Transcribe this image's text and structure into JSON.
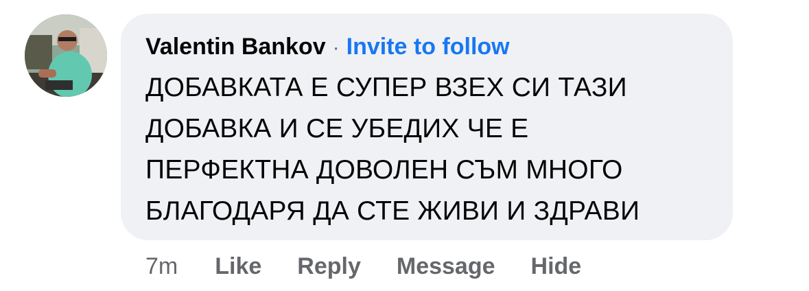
{
  "comment": {
    "author": "Valentin Bankov",
    "separator": "·",
    "invite_label": "Invite to follow",
    "text": "ДОБАВКАТА Е СУПЕР ВЗЕХ СИ ТАЗИ\nДОБАВКА И СЕ УБЕДИХ ЧЕ Е\nПЕРФЕКТНА ДОВОЛЕН СЪМ МНОГО\nБЛАГОДАРЯ ДА СТЕ ЖИВИ И ЗДРАВИ",
    "timestamp": "7m"
  },
  "actions": {
    "like": "Like",
    "reply": "Reply",
    "message": "Message",
    "hide": "Hide"
  },
  "colors": {
    "bubble_bg": "#eff1f4",
    "link_blue": "#1877f2",
    "secondary_text": "#65676b",
    "primary_text": "#050505"
  },
  "icons": {
    "avatar": "user-profile-photo"
  }
}
